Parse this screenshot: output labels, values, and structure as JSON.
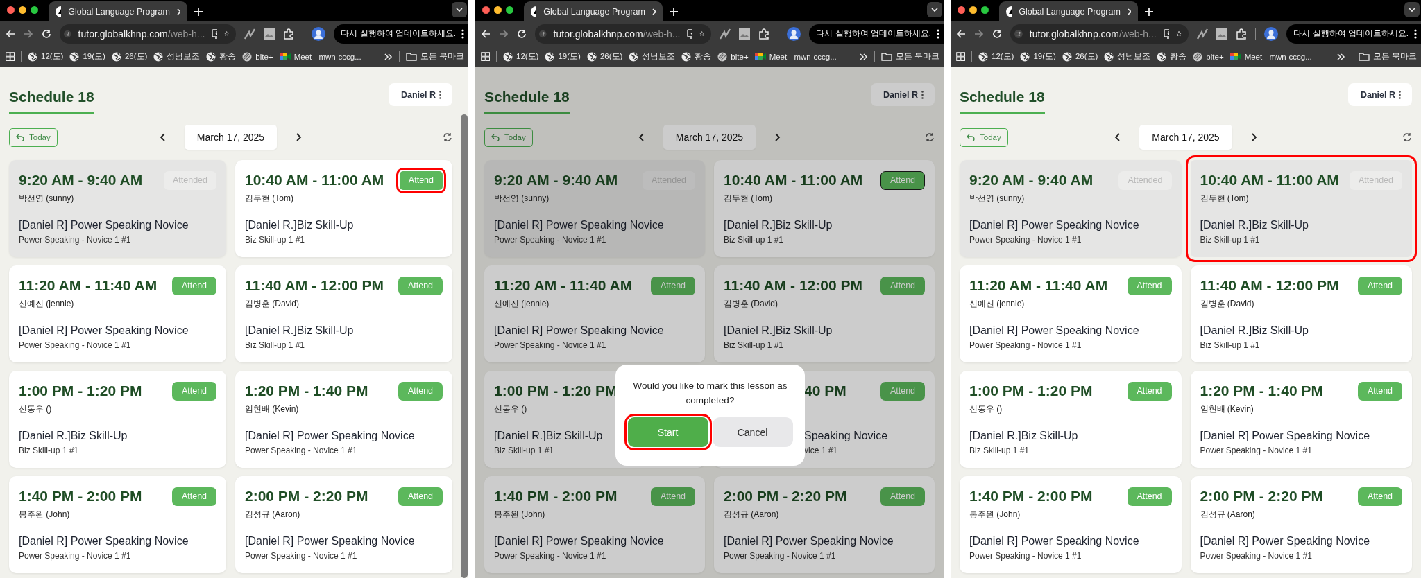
{
  "windows": [
    {
      "tab": {
        "title": "Global Language Program"
      },
      "address": {
        "host": "tutor.globalkhnp.com",
        "path": "/web-h..."
      },
      "update_button": "다시 실행하여 업데이트하세요.",
      "bookmarks": [
        {
          "label": "12(토)",
          "kind": "globe"
        },
        {
          "label": "19(토)",
          "kind": "globe"
        },
        {
          "label": "26(토)",
          "kind": "globe"
        },
        {
          "label": "성남보조",
          "kind": "globe"
        },
        {
          "label": "황송",
          "kind": "globe"
        },
        {
          "label": "bite+",
          "kind": "striped"
        },
        {
          "label": "Meet - mwn-cccg...",
          "kind": "meet"
        }
      ],
      "all_bookmarks": "모든 북마크",
      "page": {
        "title": "Schedule 18",
        "user_button": "Daniel R",
        "today_button": "Today",
        "date": "March 17, 2025",
        "scrollbar": true,
        "dimmed": false,
        "lessons": [
          {
            "time": "9:20 AM - 9:40 AM",
            "student": "박선영 (sunny)",
            "course": "[Daniel R] Power Speaking Novice",
            "subtitle": "Power Speaking - Novice 1 #1",
            "button": "Attended",
            "attended": true,
            "highlighted": false,
            "button_highlighted": false,
            "button_focused": false
          },
          {
            "time": "10:40 AM - 11:00 AM",
            "student": "김두현 (Tom)",
            "course": "[Daniel R.]Biz Skill-Up",
            "subtitle": "Biz Skill-up 1 #1",
            "button": "Attend",
            "attended": false,
            "highlighted": false,
            "button_highlighted": true,
            "button_focused": false
          },
          {
            "time": "11:20 AM - 11:40 AM",
            "student": "신예진 (jennie)",
            "course": "[Daniel R] Power Speaking Novice",
            "subtitle": "Power Speaking - Novice 1 #1",
            "button": "Attend",
            "attended": false,
            "highlighted": false,
            "button_highlighted": false,
            "button_focused": false
          },
          {
            "time": "11:40 AM - 12:00 PM",
            "student": "김병훈 (David)",
            "course": "[Daniel R.]Biz Skill-Up",
            "subtitle": "Biz Skill-up 1 #1",
            "button": "Attend",
            "attended": false,
            "highlighted": false,
            "button_highlighted": false,
            "button_focused": false
          },
          {
            "time": "1:00 PM - 1:20 PM",
            "student": "신동우 ()",
            "course": "[Daniel R.]Biz Skill-Up",
            "subtitle": "Biz Skill-up 1 #1",
            "button": "Attend",
            "attended": false,
            "highlighted": false,
            "button_highlighted": false,
            "button_focused": false
          },
          {
            "time": "1:20 PM - 1:40 PM",
            "student": "임현배 (Kevin)",
            "course": "[Daniel R] Power Speaking Novice",
            "subtitle": "Power Speaking - Novice 1 #1",
            "button": "Attend",
            "attended": false,
            "highlighted": false,
            "button_highlighted": false,
            "button_focused": false
          },
          {
            "time": "1:40 PM - 2:00 PM",
            "student": "봉주완 (John)",
            "course": "[Daniel R] Power Speaking Novice",
            "subtitle": "Power Speaking - Novice 1 #1",
            "button": "Attend",
            "attended": false,
            "highlighted": false,
            "button_highlighted": false,
            "button_focused": false
          },
          {
            "time": "2:00 PM - 2:20 PM",
            "student": "김성규 (Aaron)",
            "course": "[Daniel R] Power Speaking Novice",
            "subtitle": "Power Speaking - Novice 1 #1",
            "button": "Attend",
            "attended": false,
            "highlighted": false,
            "button_highlighted": false,
            "button_focused": false
          }
        ]
      }
    },
    {
      "tab": {
        "title": "Global Language Program"
      },
      "address": {
        "host": "tutor.globalkhnp.com",
        "path": "/web-h..."
      },
      "update_button": "다시 실행하여 업데이트하세요.",
      "bookmarks": [
        {
          "label": "12(토)",
          "kind": "globe"
        },
        {
          "label": "19(토)",
          "kind": "globe"
        },
        {
          "label": "26(토)",
          "kind": "globe"
        },
        {
          "label": "성남보조",
          "kind": "globe"
        },
        {
          "label": "황송",
          "kind": "globe"
        },
        {
          "label": "bite+",
          "kind": "striped"
        },
        {
          "label": "Meet - mwn-cccg...",
          "kind": "meet"
        }
      ],
      "all_bookmarks": "모든 북마크",
      "page": {
        "title": "Schedule 18",
        "user_button": "Daniel R",
        "today_button": "Today",
        "date": "March 17, 2025",
        "scrollbar": false,
        "dimmed": true,
        "lessons": [
          {
            "time": "9:20 AM - 9:40 AM",
            "student": "박선영 (sunny)",
            "course": "[Daniel R] Power Speaking Novice",
            "subtitle": "Power Speaking - Novice 1 #1",
            "button": "Attended",
            "attended": true,
            "highlighted": false,
            "button_highlighted": false,
            "button_focused": false
          },
          {
            "time": "10:40 AM - 11:00 AM",
            "student": "김두현 (Tom)",
            "course": "[Daniel R.]Biz Skill-Up",
            "subtitle": "Biz Skill-up 1 #1",
            "button": "Attend",
            "attended": false,
            "highlighted": false,
            "button_highlighted": false,
            "button_focused": true
          },
          {
            "time": "11:20 AM - 11:40 AM",
            "student": "신예진 (jennie)",
            "course": "[Daniel R] Power Speaking Novice",
            "subtitle": "Power Speaking - Novice 1 #1",
            "button": "Attend",
            "attended": false,
            "highlighted": false,
            "button_highlighted": false,
            "button_focused": false
          },
          {
            "time": "11:40 AM - 12:00 PM",
            "student": "김병훈 (David)",
            "course": "[Daniel R.]Biz Skill-Up",
            "subtitle": "Biz Skill-up 1 #1",
            "button": "Attend",
            "attended": false,
            "highlighted": false,
            "button_highlighted": false,
            "button_focused": false
          },
          {
            "time": "1:00 PM - 1:20 PM",
            "student": "신동우 ()",
            "course": "[Daniel R.]Biz Skill-Up",
            "subtitle": "Biz Skill-up 1 #1",
            "attended": false,
            "highlighted": false
          },
          {
            "time": "40 PM",
            "course": "Speaking Novice",
            "subtitle": "vice 1 #1",
            "button": "Attend",
            "attended": false,
            "highlighted": false,
            "button_highlighted": false,
            "button_focused": false,
            "covered": true
          },
          {
            "time": "1:40 PM - 2:00 PM",
            "student": "봉주완 (John)",
            "course": "[Daniel R] Power Speaking Novice",
            "subtitle": "Power Speaking - Novice 1 #1",
            "button": "Attend",
            "attended": false,
            "highlighted": false,
            "button_highlighted": false,
            "button_focused": false
          },
          {
            "time": "2:00 PM - 2:20 PM",
            "student": "김성규 (Aaron)",
            "course": "[Daniel R] Power Speaking Novice",
            "subtitle": "Power Speaking - Novice 1 #1",
            "button": "Attend",
            "attended": false,
            "highlighted": false,
            "button_highlighted": false,
            "button_focused": false
          }
        ],
        "dialog": {
          "message": "Would you like to mark this lesson as completed?",
          "buttons": [
            {
              "label": "Start",
              "kind": "confirm",
              "highlighted": true
            },
            {
              "label": "Cancel",
              "kind": "cancel",
              "highlighted": false
            }
          ]
        }
      }
    },
    {
      "tab": {
        "title": "Global Language Program"
      },
      "address": {
        "host": "tutor.globalkhnp.com",
        "path": "/web-h..."
      },
      "update_button": "다시 실행하여 업데이트하세요.",
      "bookmarks": [
        {
          "label": "12(토)",
          "kind": "globe"
        },
        {
          "label": "19(토)",
          "kind": "globe"
        },
        {
          "label": "26(토)",
          "kind": "globe"
        },
        {
          "label": "성남보조",
          "kind": "globe"
        },
        {
          "label": "황송",
          "kind": "globe"
        },
        {
          "label": "bite+",
          "kind": "striped"
        },
        {
          "label": "Meet - mwn-cccg...",
          "kind": "meet"
        }
      ],
      "all_bookmarks": "모든 북마크",
      "page": {
        "title": "Schedule 18",
        "user_button": "Daniel R",
        "today_button": "Today",
        "date": "March 17, 2025",
        "scrollbar": false,
        "dimmed": false,
        "lessons": [
          {
            "time": "9:20 AM - 9:40 AM",
            "student": "박선영 (sunny)",
            "course": "[Daniel R] Power Speaking Novice",
            "subtitle": "Power Speaking - Novice 1 #1",
            "button": "Attended",
            "attended": true,
            "highlighted": false,
            "button_highlighted": false,
            "button_focused": false
          },
          {
            "time": "10:40 AM - 11:00 AM",
            "student": "김두현 (Tom)",
            "course": "[Daniel R.]Biz Skill-Up",
            "subtitle": "Biz Skill-up 1 #1",
            "button": "Attended",
            "attended": true,
            "highlighted": true,
            "button_highlighted": false,
            "button_focused": false
          },
          {
            "time": "11:20 AM - 11:40 AM",
            "student": "신예진 (jennie)",
            "course": "[Daniel R] Power Speaking Novice",
            "subtitle": "Power Speaking - Novice 1 #1",
            "button": "Attend",
            "attended": false,
            "highlighted": false,
            "button_highlighted": false,
            "button_focused": false
          },
          {
            "time": "11:40 AM - 12:00 PM",
            "student": "김병훈 (David)",
            "course": "[Daniel R.]Biz Skill-Up",
            "subtitle": "Biz Skill-up 1 #1",
            "button": "Attend",
            "attended": false,
            "highlighted": false,
            "button_highlighted": false,
            "button_focused": false
          },
          {
            "time": "1:00 PM - 1:20 PM",
            "student": "신동우 ()",
            "course": "[Daniel R.]Biz Skill-Up",
            "subtitle": "Biz Skill-up 1 #1",
            "button": "Attend",
            "attended": false,
            "highlighted": false,
            "button_highlighted": false,
            "button_focused": false
          },
          {
            "time": "1:20 PM - 1:40 PM",
            "student": "임현배 (Kevin)",
            "course": "[Daniel R] Power Speaking Novice",
            "subtitle": "Power Speaking - Novice 1 #1",
            "button": "Attend",
            "attended": false,
            "highlighted": false,
            "button_highlighted": false,
            "button_focused": false
          },
          {
            "time": "1:40 PM - 2:00 PM",
            "student": "봉주완 (John)",
            "course": "[Daniel R] Power Speaking Novice",
            "subtitle": "Power Speaking - Novice 1 #1",
            "button": "Attend",
            "attended": false,
            "highlighted": false,
            "button_highlighted": false,
            "button_focused": false
          },
          {
            "time": "2:00 PM - 2:20 PM",
            "student": "김성규 (Aaron)",
            "course": "[Daniel R] Power Speaking Novice",
            "subtitle": "Power Speaking - Novice 1 #1",
            "button": "Attend",
            "attended": false,
            "highlighted": false,
            "button_highlighted": false,
            "button_focused": false
          }
        ]
      }
    }
  ]
}
